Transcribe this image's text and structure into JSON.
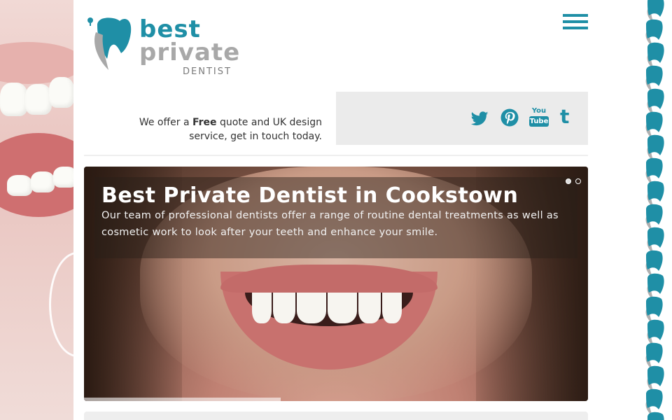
{
  "logo": {
    "line1": "best",
    "line2": "private",
    "line3": "DENTIST",
    "colors": {
      "teal": "#1f8fa6",
      "grey": "#a8a8a8"
    }
  },
  "menu": {
    "icon": "hamburger-menu-icon"
  },
  "tagline": {
    "before": "We offer a ",
    "bold": "Free",
    "after": " quote and UK design service, get in touch today."
  },
  "social": [
    {
      "name": "twitter-icon"
    },
    {
      "name": "pinterest-icon"
    },
    {
      "name": "youtube-icon",
      "text_top": "You",
      "text_bottom": "Tube"
    },
    {
      "name": "tumblr-icon",
      "text": "t"
    }
  ],
  "slider": {
    "title": "Best Private Dentist in Cookstown",
    "text": "Our team of professional dentists offer a range of routine dental treatments as well as cosmetic work to look after your teeth and enhance your smile.",
    "dots": [
      {
        "active": true
      },
      {
        "active": false
      }
    ],
    "progress": 0.39
  },
  "accent_color": "#1f8fa6"
}
